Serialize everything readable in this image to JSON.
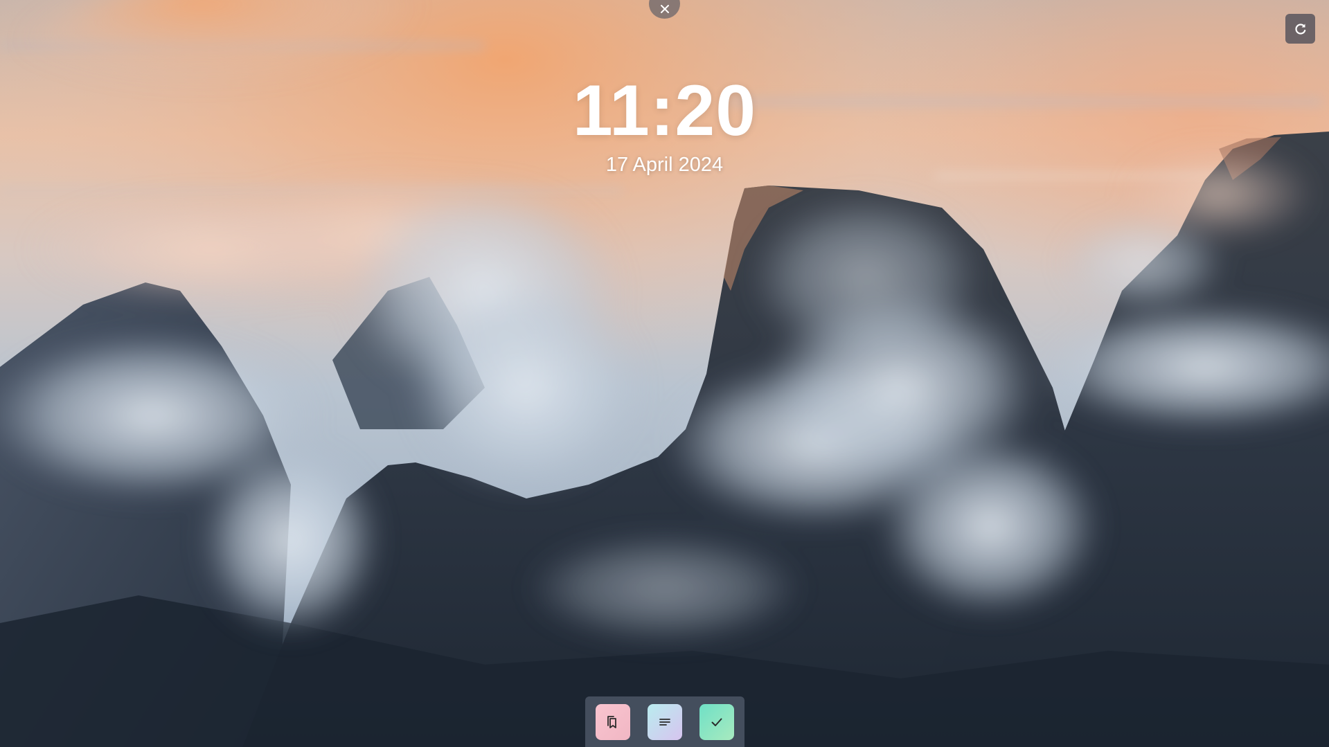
{
  "clock": {
    "time": "11:20",
    "date": "17 April 2024"
  },
  "controls": {
    "close_icon": "close-icon",
    "refresh_icon": "refresh-icon"
  },
  "dock": {
    "items": [
      {
        "id": "bookmarks",
        "icon": "bookmarks-icon",
        "color": "#F6BECB"
      },
      {
        "id": "notes",
        "icon": "notes-lines-icon",
        "color": "#C6DCEF"
      },
      {
        "id": "todos",
        "icon": "checkmark-icon",
        "color": "#84E3C4"
      }
    ]
  },
  "wallpaper": {
    "subject": "misty-mountain-peaks-sunrise",
    "sky_color": "#F0B48A",
    "mountain_color": "#26303D"
  }
}
